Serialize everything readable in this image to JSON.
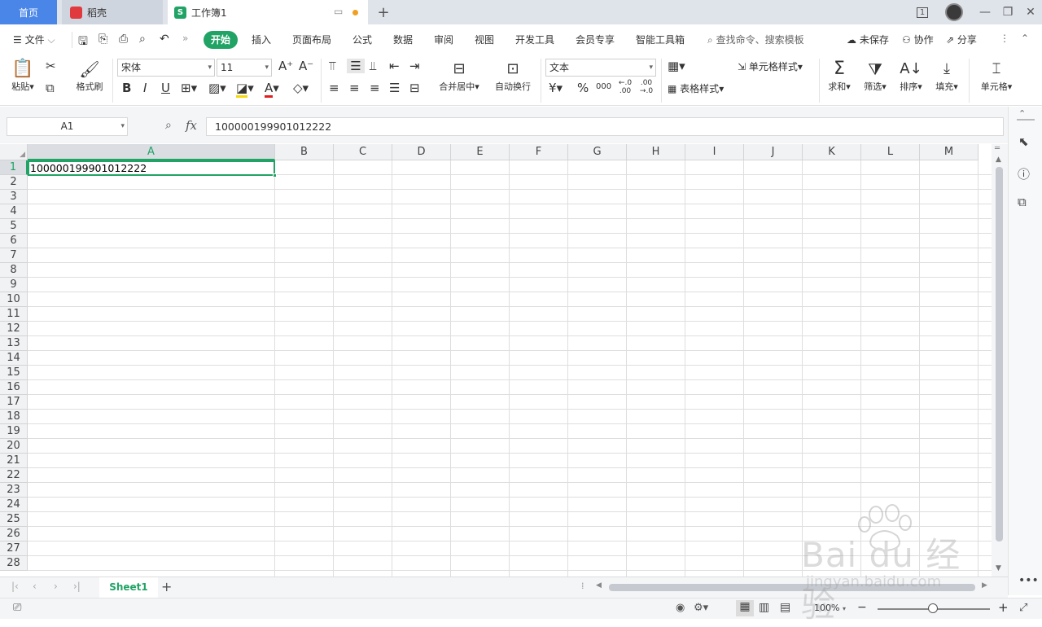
{
  "titlebar": {
    "tabs": [
      {
        "label": "首页"
      },
      {
        "label": "稻壳"
      },
      {
        "label": "工作簿1"
      }
    ],
    "window_badge": "1",
    "add_tab": "+"
  },
  "menubar": {
    "file": "文件",
    "items": [
      "开始",
      "插入",
      "页面布局",
      "公式",
      "数据",
      "审阅",
      "视图",
      "开发工具",
      "会员专享",
      "智能工具箱"
    ],
    "search_placeholder": "查找命令、搜索模板",
    "unsaved": "未保存",
    "collab": "协作",
    "share": "分享"
  },
  "ribbon": {
    "paste": "粘贴",
    "format_painter": "格式刷",
    "font_name": "宋体",
    "font_size": "11",
    "merge_center": "合并居中",
    "wrap_text": "自动换行",
    "number_format": "文本",
    "cell_style": "单元格样式",
    "table_style": "表格样式",
    "sum": "求和",
    "filter": "筛选",
    "sort": "排序",
    "fill": "填充",
    "cell": "单元格",
    "currency_symbol": "¥",
    "percent_symbol": "%",
    "thousands": "000",
    "inc_decimal": "←.0 .00",
    "dec_decimal": ".00 →.0"
  },
  "formula_bar": {
    "name_box": "A1",
    "fx": "fx",
    "value": "100000199901012222"
  },
  "grid": {
    "columns": [
      "A",
      "B",
      "C",
      "D",
      "E",
      "F",
      "G",
      "H",
      "I",
      "J",
      "K",
      "L",
      "M"
    ],
    "rows": [
      "1",
      "2",
      "3",
      "4",
      "5",
      "6",
      "7",
      "8",
      "9",
      "10",
      "11",
      "12",
      "13",
      "14",
      "15",
      "16",
      "17",
      "18",
      "19",
      "20",
      "21",
      "22",
      "23",
      "24",
      "25",
      "26",
      "27",
      "28"
    ],
    "cell_a1": "100000199901012222"
  },
  "sheets": {
    "active": "Sheet1",
    "add": "+"
  },
  "statusbar": {
    "zoom": "100%",
    "minus": "−",
    "plus": "+"
  },
  "watermark": {
    "brand": "Bai du 经验",
    "url": "jingyan.baidu.com"
  },
  "colors": {
    "accent_green": "#21a366",
    "home_tab_blue": "#4a86e8",
    "titlebar_bg": "#dfe3ea"
  }
}
